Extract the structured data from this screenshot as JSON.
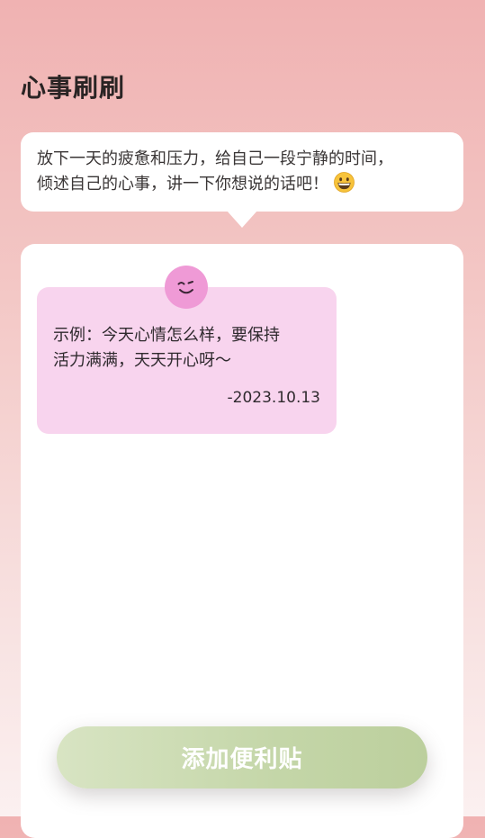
{
  "header": {
    "title": "心事刷刷"
  },
  "intro": {
    "line1": "放下一天的疲惫和压力，给自己一段宁静的时间，",
    "line2": "倾述自己的心事，讲一下你想说的话吧！",
    "emoji": "grinning-face-icon"
  },
  "notes": [
    {
      "line1": "示例：今天心情怎么样，要保持",
      "line2": "活力满满，天天开心呀～",
      "date": "-2023.10.13",
      "color": "#f8d4ee",
      "face": "smiley-face-icon"
    }
  ],
  "actions": {
    "add_label": "添加便利贴"
  },
  "colors": {
    "background_top": "#f0b2b2",
    "background_bottom": "#fbf0f0",
    "button_start": "#d8e4c3",
    "button_end": "#bccf9d"
  }
}
